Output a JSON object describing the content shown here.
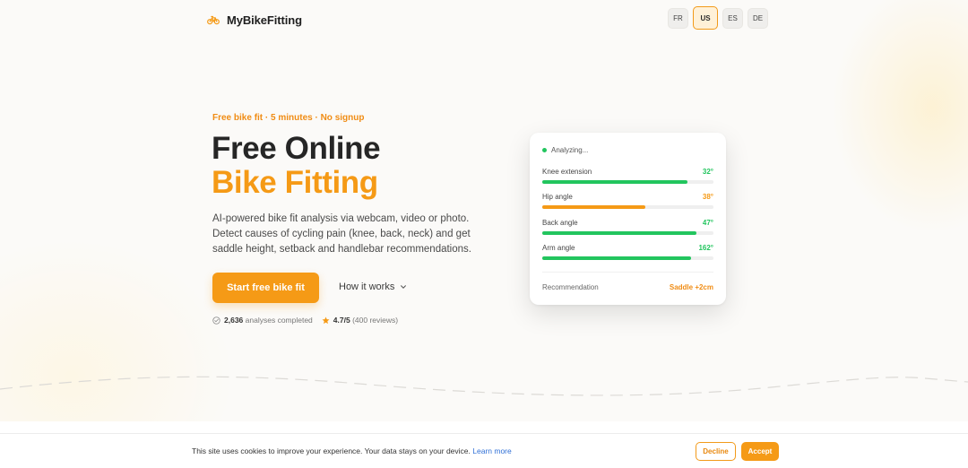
{
  "brand": {
    "name": "MyBikeFitting",
    "icon": "bicycle-icon",
    "accent_color": "#f59a16"
  },
  "languages": [
    {
      "code": "FR",
      "active": false
    },
    {
      "code": "US",
      "active": true
    },
    {
      "code": "ES",
      "active": false
    },
    {
      "code": "DE",
      "active": false
    }
  ],
  "hero": {
    "eyebrow": "Free bike fit · 5 minutes · No signup",
    "title_line1": "Free Online",
    "title_line2": "Bike Fitting",
    "description": "AI-powered bike fit analysis via webcam, video or photo. Detect causes of cycling pain (knee, back, neck) and get saddle height, setback and handlebar recommendations.",
    "cta_label": "Start free bike fit",
    "secondary_label": "How it works",
    "stats": {
      "analyses_count": "2,636",
      "analyses_label": "analyses completed",
      "rating": "4.7/5",
      "reviews": "(400 reviews)"
    }
  },
  "analysis_card": {
    "status": "Analyzing...",
    "metrics": [
      {
        "label": "Knee extension",
        "value": "32°",
        "progress": 0.85,
        "color": "#22c55e"
      },
      {
        "label": "Hip angle",
        "value": "38°",
        "progress": 0.6,
        "color": "#f59a16"
      },
      {
        "label": "Back angle",
        "value": "47°",
        "progress": 0.9,
        "color": "#22c55e"
      },
      {
        "label": "Arm angle",
        "value": "162°",
        "progress": 0.87,
        "color": "#22c55e"
      }
    ],
    "recommendation_label": "Recommendation",
    "recommendation_value": "Saddle +2cm"
  },
  "cookie_banner": {
    "text": "This site uses cookies to improve your experience. Your data stays on your device.",
    "link_label": "Learn more",
    "decline_label": "Decline",
    "accept_label": "Accept"
  }
}
